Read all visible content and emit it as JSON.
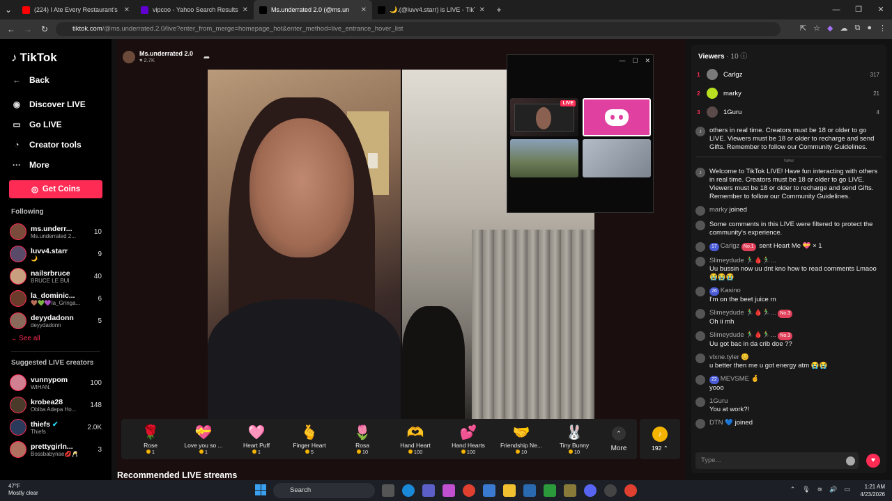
{
  "browser": {
    "tabs": [
      {
        "title": "(224) I Ate Every Restaurant's Fr",
        "color": "#ff0000"
      },
      {
        "title": "vipcoo - Yahoo Search Results",
        "color": "#6001d2"
      },
      {
        "title": "Ms.underrated 2.0 (@ms.un",
        "color": "#000000",
        "active": true
      },
      {
        "title": "🌙.(@luvv4.starr) is LIVE - TikT",
        "color": "#000000"
      }
    ],
    "new_tab_label": "+",
    "url_host": "tiktok.com",
    "url_path": "/@ms.underrated.2.0/live?enter_from_merge=homepage_hot&enter_method=live_entrance_hover_list"
  },
  "sidebar": {
    "brand": "TikTok",
    "back_label": "Back",
    "nav": [
      {
        "label": "Discover LIVE",
        "icon": "live-avatar-icon"
      },
      {
        "label": "Go LIVE",
        "icon": "video-camera-icon"
      },
      {
        "label": "Creator tools",
        "icon": "lightbulb-icon"
      },
      {
        "label": "More",
        "icon": "ellipsis-icon"
      }
    ],
    "coins_label": "Get Coins",
    "following_title": "Following",
    "following": [
      {
        "name": "ms.underr...",
        "sub": "Ms.underrated 2...",
        "count": "10",
        "color": "#7a4a3a"
      },
      {
        "name": "luvv4.starr",
        "sub": "🌙.",
        "count": "9",
        "color": "#5a4a6a"
      },
      {
        "name": "nailsrbruce",
        "sub": "BRUCE LE BUI",
        "count": "40",
        "color": "#c8a080"
      },
      {
        "name": "la_dominic...",
        "sub": "🤎💚💜la_Gringa...",
        "count": "6",
        "color": "#6a3a2a"
      },
      {
        "name": "deyydadonn",
        "sub": "deyydadonn",
        "count": "5",
        "color": "#8a6a5a"
      }
    ],
    "see_all_label": "See all",
    "suggested_title": "Suggested LIVE creators",
    "suggested": [
      {
        "name": "vunnypom",
        "sub": "WIHAN.",
        "count": "100",
        "color": "#d08090"
      },
      {
        "name": "krobea28",
        "sub": "Obiba Adepa Ho...",
        "count": "148",
        "color": "#4a3a2a"
      },
      {
        "name": "thiefs",
        "sub": "Thiefs",
        "count": "2.0K",
        "color": "#2a3a5a",
        "verified": true
      },
      {
        "name": "prettygirln...",
        "sub": "Bossbabynae💋🥂",
        "count": "3",
        "color": "#b07060"
      }
    ]
  },
  "stream": {
    "host_name": "Ms.underrated 2.0",
    "host_likes": "2.7K",
    "recommended_title": "Recommended LIVE streams",
    "popup_live_tag": "LIVE"
  },
  "gifts": [
    {
      "name": "Rose",
      "price": "1",
      "icon": "🌹"
    },
    {
      "name": "Love you so ...",
      "price": "1",
      "icon": "💝"
    },
    {
      "name": "Heart Puff",
      "price": "1",
      "icon": "🩷"
    },
    {
      "name": "Finger Heart",
      "price": "5",
      "icon": "🫰"
    },
    {
      "name": "Rosa",
      "price": "10",
      "icon": "🌷"
    },
    {
      "name": "Hand Heart",
      "price": "100",
      "icon": "🫶"
    },
    {
      "name": "Hand Hearts",
      "price": "100",
      "icon": "💕"
    },
    {
      "name": "Friendship Ne...",
      "price": "10",
      "icon": "🤝"
    },
    {
      "name": "Tiny Bunny",
      "price": "10",
      "icon": "🐰"
    }
  ],
  "gifts_more_label": "More",
  "coin_balance": "192",
  "chat": {
    "viewers_title": "Viewers",
    "viewers_count": "· 10",
    "top_viewers": [
      {
        "rank": "1",
        "name": "Carlgz",
        "score": "317",
        "color": "#7a7a7a"
      },
      {
        "rank": "2",
        "name": "marky",
        "score": "21",
        "color": "#b8e020"
      },
      {
        "rank": "3",
        "name": "1Guru",
        "score": "4",
        "color": "#5a4a4a"
      }
    ],
    "welcome_partial": "others in real time. Creators must be 18 or older to go LIVE. Viewers must be 18 or older to recharge and send Gifts. Remember to follow our Community Guidelines.",
    "new_label": "New",
    "welcome_full": "Welcome to TikTok LIVE! Have fun interacting with others in real time. Creators must be 18 or older to go LIVE. Viewers must be 18 or older to recharge and send Gifts. Remember to follow our Community Guidelines.",
    "messages": [
      {
        "user": "marky",
        "text": "joined"
      },
      {
        "user": "",
        "text": "Some comments in this LIVE were filtered to protect the community's experience."
      },
      {
        "user": "Carlgz",
        "level": "17",
        "rank": "No.1",
        "text": "sent Heart Me 💝 × 1"
      },
      {
        "user": "Slimeydude 🏃‍♂️🩸🏃‍♂️...",
        "text": "Uu bussin now uu dnt kno how to read comments Lmaoo 😭😭😭"
      },
      {
        "user": "Kasino",
        "level": "26",
        "text": "I'm on the beet juice rn"
      },
      {
        "user": "Slimeydude 🏃‍♂️🩸🏃‍♂️...",
        "rank": "No.3",
        "text": "Oh ii mh"
      },
      {
        "user": "Slimeydude 🏃‍♂️🩸🏃‍♂️...",
        "rank": "No.3",
        "text": "Uu got bac in da crib doe ??"
      },
      {
        "user": "vlxne.tyler 😊",
        "text": "u better then me u got energy atm 😭😭"
      },
      {
        "user": "MEVSME 🤞",
        "level": "22",
        "text": "yooo"
      },
      {
        "user": "1Guru",
        "text": "You at work?!"
      },
      {
        "user": "DTN 💙",
        "text": "joined"
      }
    ],
    "input_placeholder": "Type..."
  },
  "taskbar": {
    "temp": "47°F",
    "weather": "Mostly clear",
    "search_label": "Search",
    "time": "1:21 AM",
    "date": "4/23/2026"
  }
}
